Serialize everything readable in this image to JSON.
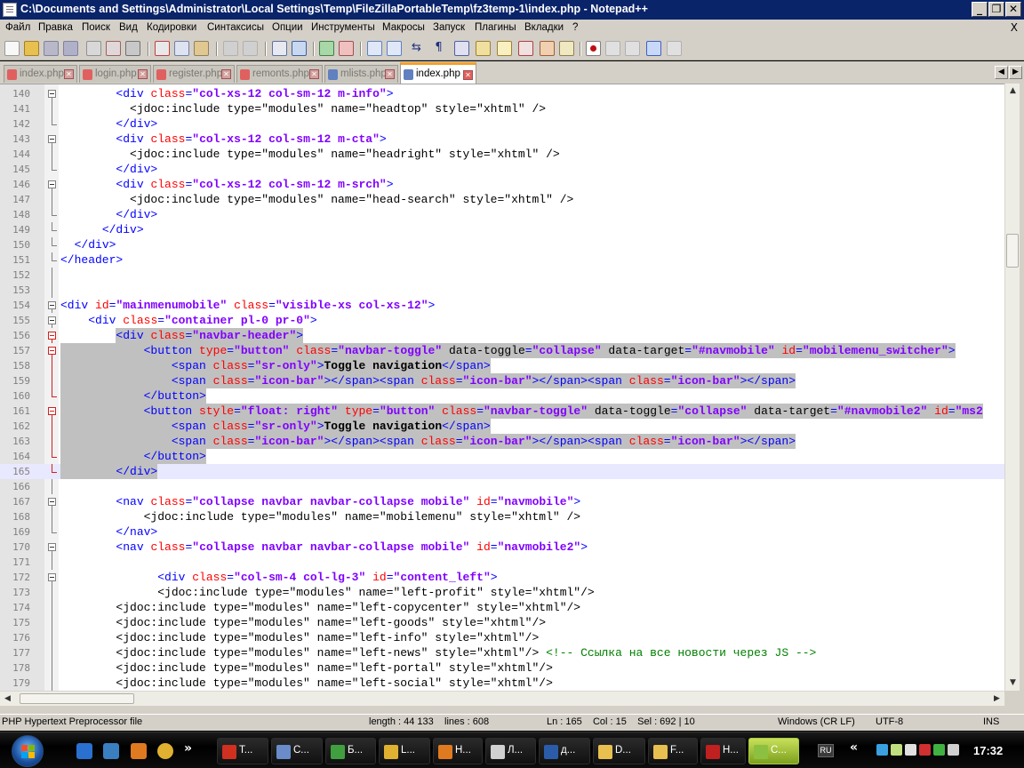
{
  "window": {
    "title": "C:\\Documents and Settings\\Administrator\\Local Settings\\Temp\\FileZillaPortableTemp\\fz3temp-1\\index.php - Notepad++",
    "minimize": "_",
    "maximize": "❐",
    "close": "✕"
  },
  "menu": {
    "items": [
      "Файл",
      "Правка",
      "Поиск",
      "Вид",
      "Кодировки",
      "Синтаксисы",
      "Опции",
      "Инструменты",
      "Макросы",
      "Запуск",
      "Плагины",
      "Вкладки",
      "?"
    ],
    "close": "X"
  },
  "tabs": [
    {
      "label": "index.php",
      "active": false
    },
    {
      "label": "login.php",
      "active": false
    },
    {
      "label": "register.php",
      "active": false
    },
    {
      "label": "remonts.php",
      "active": false
    },
    {
      "label": "mlists.php",
      "active": false
    },
    {
      "label": "index.php",
      "active": true
    }
  ],
  "editor": {
    "lines": [
      {
        "n": "140",
        "segs": [
          [
            "jd",
            "        "
          ],
          [
            "tg",
            "<div "
          ],
          [
            "at",
            "class"
          ],
          [
            "tg",
            "="
          ],
          [
            "st",
            "\"col-xs-12 col-sm-12 m-info\""
          ],
          [
            "tg",
            ">"
          ]
        ]
      },
      {
        "n": "141",
        "segs": [
          [
            "jd",
            "          <jdoc:include type=\"modules\" name=\"headtop\" style=\"xhtml\" />"
          ]
        ]
      },
      {
        "n": "142",
        "segs": [
          [
            "jd",
            "        "
          ],
          [
            "tg",
            "</div>"
          ]
        ]
      },
      {
        "n": "143",
        "segs": [
          [
            "jd",
            "        "
          ],
          [
            "tg",
            "<div "
          ],
          [
            "at",
            "class"
          ],
          [
            "tg",
            "="
          ],
          [
            "st",
            "\"col-xs-12 col-sm-12 m-cta\""
          ],
          [
            "tg",
            ">"
          ]
        ]
      },
      {
        "n": "144",
        "segs": [
          [
            "jd",
            "          <jdoc:include type=\"modules\" name=\"headright\" style=\"xhtml\" />"
          ]
        ]
      },
      {
        "n": "145",
        "segs": [
          [
            "jd",
            "        "
          ],
          [
            "tg",
            "</div>"
          ]
        ]
      },
      {
        "n": "146",
        "segs": [
          [
            "jd",
            "        "
          ],
          [
            "tg",
            "<div "
          ],
          [
            "at",
            "class"
          ],
          [
            "tg",
            "="
          ],
          [
            "st",
            "\"col-xs-12 col-sm-12 m-srch\""
          ],
          [
            "tg",
            ">"
          ]
        ]
      },
      {
        "n": "147",
        "segs": [
          [
            "jd",
            "          <jdoc:include type=\"modules\" name=\"head-search\" style=\"xhtml\" />"
          ]
        ]
      },
      {
        "n": "148",
        "segs": [
          [
            "jd",
            "        "
          ],
          [
            "tg",
            "</div>"
          ]
        ]
      },
      {
        "n": "149",
        "segs": [
          [
            "jd",
            "      "
          ],
          [
            "tg",
            "</div>"
          ]
        ]
      },
      {
        "n": "150",
        "segs": [
          [
            "jd",
            "  "
          ],
          [
            "tg",
            "</div>"
          ]
        ]
      },
      {
        "n": "151",
        "segs": [
          [
            "tg",
            "</header>"
          ]
        ]
      },
      {
        "n": "152",
        "segs": []
      },
      {
        "n": "153",
        "segs": []
      },
      {
        "n": "154",
        "segs": [
          [
            "tg",
            "<div "
          ],
          [
            "at",
            "id"
          ],
          [
            "tg",
            "="
          ],
          [
            "st",
            "\"mainmenumobile\""
          ],
          [
            "jd",
            " "
          ],
          [
            "at",
            "class"
          ],
          [
            "tg",
            "="
          ],
          [
            "st",
            "\"visible-xs col-xs-12\""
          ],
          [
            "tg",
            ">"
          ]
        ]
      },
      {
        "n": "155",
        "segs": [
          [
            "jd",
            "    "
          ],
          [
            "tg",
            "<div "
          ],
          [
            "at",
            "class"
          ],
          [
            "tg",
            "="
          ],
          [
            "st",
            "\"container pl-0 pr-0\""
          ],
          [
            "tg",
            ">"
          ]
        ]
      },
      {
        "n": "156",
        "segs": [
          [
            "jd",
            "        "
          ],
          [
            "tg",
            "<div "
          ],
          [
            "at",
            "class"
          ],
          [
            "tg",
            "="
          ],
          [
            "st",
            "\"navbar-header\""
          ],
          [
            "tg",
            ">"
          ]
        ]
      },
      {
        "n": "157",
        "segs": [
          [
            "jd",
            "            "
          ],
          [
            "tg",
            "<button "
          ],
          [
            "at",
            "type"
          ],
          [
            "tg",
            "="
          ],
          [
            "st",
            "\"button\""
          ],
          [
            "jd",
            " "
          ],
          [
            "at",
            "class"
          ],
          [
            "tg",
            "="
          ],
          [
            "st",
            "\"navbar-toggle\""
          ],
          [
            "jd",
            " data-toggle"
          ],
          [
            "tg",
            "="
          ],
          [
            "st",
            "\"collapse\""
          ],
          [
            "jd",
            " data-target"
          ],
          [
            "tg",
            "="
          ],
          [
            "st",
            "\"#navmobile\""
          ],
          [
            "jd",
            " "
          ],
          [
            "at",
            "id"
          ],
          [
            "tg",
            "="
          ],
          [
            "st",
            "\"mobilemenu_switcher\""
          ],
          [
            "tg",
            ">"
          ]
        ]
      },
      {
        "n": "158",
        "segs": [
          [
            "jd",
            "                "
          ],
          [
            "tg",
            "<span "
          ],
          [
            "at",
            "class"
          ],
          [
            "tg",
            "="
          ],
          [
            "st",
            "\"sr-only\""
          ],
          [
            "tg",
            ">"
          ],
          [
            "tx",
            "Toggle navigation"
          ],
          [
            "tg",
            "</span>"
          ]
        ]
      },
      {
        "n": "159",
        "segs": [
          [
            "jd",
            "                "
          ],
          [
            "tg",
            "<span "
          ],
          [
            "at",
            "class"
          ],
          [
            "tg",
            "="
          ],
          [
            "st",
            "\"icon-bar\""
          ],
          [
            "tg",
            "></span><span "
          ],
          [
            "at",
            "class"
          ],
          [
            "tg",
            "="
          ],
          [
            "st",
            "\"icon-bar\""
          ],
          [
            "tg",
            "></span><span "
          ],
          [
            "at",
            "class"
          ],
          [
            "tg",
            "="
          ],
          [
            "st",
            "\"icon-bar\""
          ],
          [
            "tg",
            "></span>"
          ]
        ]
      },
      {
        "n": "160",
        "segs": [
          [
            "jd",
            "            "
          ],
          [
            "tg",
            "</button>"
          ]
        ]
      },
      {
        "n": "161",
        "segs": [
          [
            "jd",
            "            "
          ],
          [
            "tg",
            "<button "
          ],
          [
            "at",
            "style"
          ],
          [
            "tg",
            "="
          ],
          [
            "st",
            "\"float: right\""
          ],
          [
            "jd",
            " "
          ],
          [
            "at",
            "type"
          ],
          [
            "tg",
            "="
          ],
          [
            "st",
            "\"button\""
          ],
          [
            "jd",
            " "
          ],
          [
            "at",
            "class"
          ],
          [
            "tg",
            "="
          ],
          [
            "st",
            "\"navbar-toggle\""
          ],
          [
            "jd",
            " data-toggle"
          ],
          [
            "tg",
            "="
          ],
          [
            "st",
            "\"collapse\""
          ],
          [
            "jd",
            " data-target"
          ],
          [
            "tg",
            "="
          ],
          [
            "st",
            "\"#navmobile2\""
          ],
          [
            "jd",
            " "
          ],
          [
            "at",
            "id"
          ],
          [
            "tg",
            "="
          ],
          [
            "st",
            "\"ms2"
          ]
        ]
      },
      {
        "n": "162",
        "segs": [
          [
            "jd",
            "                "
          ],
          [
            "tg",
            "<span "
          ],
          [
            "at",
            "class"
          ],
          [
            "tg",
            "="
          ],
          [
            "st",
            "\"sr-only\""
          ],
          [
            "tg",
            ">"
          ],
          [
            "tx",
            "Toggle navigation"
          ],
          [
            "tg",
            "</span>"
          ]
        ]
      },
      {
        "n": "163",
        "segs": [
          [
            "jd",
            "                "
          ],
          [
            "tg",
            "<span "
          ],
          [
            "at",
            "class"
          ],
          [
            "tg",
            "="
          ],
          [
            "st",
            "\"icon-bar\""
          ],
          [
            "tg",
            "></span><span "
          ],
          [
            "at",
            "class"
          ],
          [
            "tg",
            "="
          ],
          [
            "st",
            "\"icon-bar\""
          ],
          [
            "tg",
            "></span><span "
          ],
          [
            "at",
            "class"
          ],
          [
            "tg",
            "="
          ],
          [
            "st",
            "\"icon-bar\""
          ],
          [
            "tg",
            "></span>"
          ]
        ]
      },
      {
        "n": "164",
        "segs": [
          [
            "jd",
            "            "
          ],
          [
            "tg",
            "</button>"
          ]
        ]
      },
      {
        "n": "165",
        "segs": [
          [
            "jd",
            "        "
          ],
          [
            "tg",
            "</div>"
          ]
        ]
      },
      {
        "n": "166",
        "segs": []
      },
      {
        "n": "167",
        "segs": [
          [
            "jd",
            "        "
          ],
          [
            "tg",
            "<nav "
          ],
          [
            "at",
            "class"
          ],
          [
            "tg",
            "="
          ],
          [
            "st",
            "\"collapse navbar navbar-collapse mobile\""
          ],
          [
            "jd",
            " "
          ],
          [
            "at",
            "id"
          ],
          [
            "tg",
            "="
          ],
          [
            "st",
            "\"navmobile\""
          ],
          [
            "tg",
            ">"
          ]
        ]
      },
      {
        "n": "168",
        "segs": [
          [
            "jd",
            "            <jdoc:include type=\"modules\" name=\"mobilemenu\" style=\"xhtml\" />"
          ]
        ]
      },
      {
        "n": "169",
        "segs": [
          [
            "jd",
            "        "
          ],
          [
            "tg",
            "</nav>"
          ]
        ]
      },
      {
        "n": "170",
        "segs": [
          [
            "jd",
            "        "
          ],
          [
            "tg",
            "<nav "
          ],
          [
            "at",
            "class"
          ],
          [
            "tg",
            "="
          ],
          [
            "st",
            "\"collapse navbar navbar-collapse mobile\""
          ],
          [
            "jd",
            " "
          ],
          [
            "at",
            "id"
          ],
          [
            "tg",
            "="
          ],
          [
            "st",
            "\"navmobile2\""
          ],
          [
            "tg",
            ">"
          ]
        ]
      },
      {
        "n": "171",
        "segs": []
      },
      {
        "n": "172",
        "segs": [
          [
            "jd",
            "              "
          ],
          [
            "tg",
            "<div "
          ],
          [
            "at",
            "class"
          ],
          [
            "tg",
            "="
          ],
          [
            "st",
            "\"col-sm-4 col-lg-3\""
          ],
          [
            "jd",
            " "
          ],
          [
            "at",
            "id"
          ],
          [
            "tg",
            "="
          ],
          [
            "st",
            "\"content_left\""
          ],
          [
            "tg",
            ">"
          ]
        ]
      },
      {
        "n": "173",
        "segs": [
          [
            "jd",
            "              <jdoc:include type=\"modules\" name=\"left-profit\" style=\"xhtml\"/>"
          ]
        ]
      },
      {
        "n": "174",
        "segs": [
          [
            "jd",
            "        <jdoc:include type=\"modules\" name=\"left-copycenter\" style=\"xhtml\"/>"
          ]
        ]
      },
      {
        "n": "175",
        "segs": [
          [
            "jd",
            "        <jdoc:include type=\"modules\" name=\"left-goods\" style=\"xhtml\"/>"
          ]
        ]
      },
      {
        "n": "176",
        "segs": [
          [
            "jd",
            "        <jdoc:include type=\"modules\" name=\"left-info\" style=\"xhtml\"/>"
          ]
        ]
      },
      {
        "n": "177",
        "segs": [
          [
            "jd",
            "        <jdoc:include type=\"modules\" name=\"left-news\" style=\"xhtml\"/> "
          ],
          [
            "cm",
            "<!-- Ссылка на все новости через JS -->"
          ]
        ]
      },
      {
        "n": "178",
        "segs": [
          [
            "jd",
            "        <jdoc:include type=\"modules\" name=\"left-portal\" style=\"xhtml\"/>"
          ]
        ]
      },
      {
        "n": "179",
        "segs": [
          [
            "jd",
            "        <jdoc:include type=\"modules\" name=\"left-social\" style=\"xhtml\"/>"
          ]
        ]
      }
    ]
  },
  "statusbar": {
    "filetype": "PHP Hypertext Preprocessor file",
    "length": "length : 44 133",
    "lines": "lines : 608",
    "position": "Ln : 165    Col : 15    Sel : 692 | 10",
    "eol": "Windows (CR LF)",
    "encoding": "UTF-8",
    "mode": "INS"
  },
  "taskbar": {
    "buttons": [
      {
        "label": "T...",
        "icon": "opera-icon",
        "color": "#d03020"
      },
      {
        "label": "C...",
        "icon": "computer-icon",
        "color": "#6a8cc8"
      },
      {
        "label": "Б...",
        "icon": "wireless-icon",
        "color": "#40a040"
      },
      {
        "label": "L...",
        "icon": "chrome-icon",
        "color": "#e0b030"
      },
      {
        "label": "Н...",
        "icon": "sublime-icon",
        "color": "#e07a20"
      },
      {
        "label": "Л...",
        "icon": "book-icon",
        "color": "#d0d0d0"
      },
      {
        "label": "д...",
        "icon": "word-icon",
        "color": "#2a5caa"
      },
      {
        "label": "D...",
        "icon": "folder-icon",
        "color": "#e8c050"
      },
      {
        "label": "F...",
        "icon": "folder-icon",
        "color": "#e8c050"
      },
      {
        "label": "Н...",
        "icon": "filezilla-icon",
        "color": "#c02020"
      },
      {
        "label": "C...",
        "icon": "notepadpp-icon",
        "color": "#8cc040"
      }
    ],
    "lang": "RU",
    "clock": "17:32"
  }
}
